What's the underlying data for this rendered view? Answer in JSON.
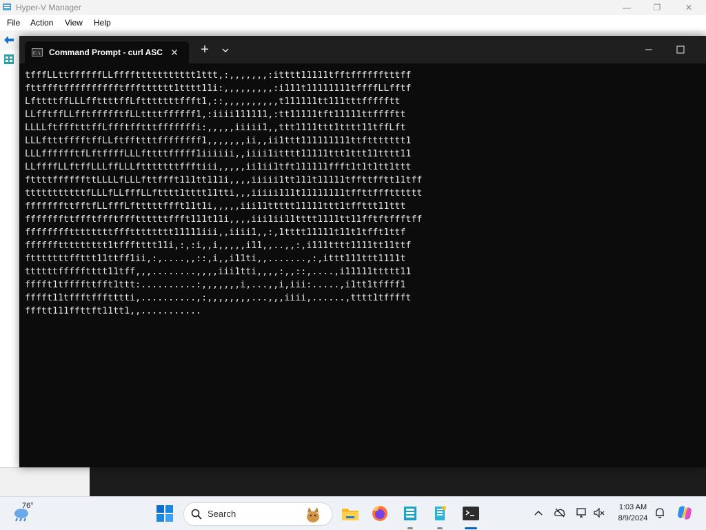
{
  "hyperv": {
    "title": "Hyper-V Manager",
    "menu": [
      "File",
      "Action",
      "View",
      "Help"
    ]
  },
  "terminal": {
    "tab_title": "Command Prompt - curl  ASC",
    "new_tab_symbol": "+",
    "close_symbol": "✕",
    "output_lines": [
      "tfffLLttffffffLLffffttttttttttt1ttt,:,,,,,,,:itttt11111tfftfffffftttff",
      "fttffftfffffffffftffftttttt1tttt11i:,,,,,,,,,:i111t11111111tffffLLfftf",
      "LfttttffLLLffttttffLftttttttffft1,::,,,,,,,,,,t111111tt111tttffffftt",
      "LLfftffLLfftffffftfLLttttffffff1,:iiii111111,:tt11111tft11111ttfffftt",
      "LLLLftffftttffLffftfftttfffffffi:,,,,,iiiii1,,ttt1111ttt1tttt11tffLft",
      "LLLftttfffftffLLftffttttffffffff1,,,,,,,ii,,ii1ttt111111111ttfttttttt1",
      "LLLfffffftfLftffffLLLfttttfffff1iiiiii,,iiii1itttt11111ttt1ttt11tttt11",
      "LLffffLLftffLLLffLLLftttttttffftiii,,,,,ii1ii1tft111111ffft1t1t1tt1ttt",
      "fttttffffffttLLLLfLLLfttffft111tt111i,,,,iiiii1tt111t11111tffttfftt11tff",
      "tttttttttttfLLLfLLfffLLftttt1tttt11tti,,,iiiii111t11111111tffttffftttttt",
      "fffffffttfftfLLfffLftttttffft11t1i,,,,,iii11ttttt11111ttt1tffttt11ttt",
      "fffffffttffftffftfffttttttffft111t11i,,,,iii1ii11tttt1111tt11fftftffftff",
      "ffffffffttttttttffftttttttt11111iii,,iiii1,,:,1tttt11111t11t1tfft1ttf",
      "ffffffttttttttt1tffftttt11i,:,:i,,i,,,,,i11,,..,,:,i111tttt1111tt11ttf",
      "ftttttttffttt11ttff1ii,:,....,,::,i,,i11ti,,.......,:,ittt111ttt1111t",
      "ttttttffffftttt11tff,,,........,,,,iii1tti,,,,:,,::,....,i11111ttttt11",
      "fffft1tffffttfft1ttt:..........:,,,,,,,i,...,,i,iii:.....,i1tt1tffff1",
      "fffft11tffftffftttti,..........,:,,,,,,,,...,,,iiii,......,tttt1tfffft",
      "ffftt111ffttft11tt1,,..........."
    ]
  },
  "taskbar": {
    "weather_temp": "76°",
    "search_placeholder": "Search",
    "time": "1:03 AM",
    "date": "8/9/2024",
    "pinned_apps": [
      "file-explorer-icon",
      "firefox-icon",
      "hyper-v-manager-icon",
      "hyper-v-icon",
      "terminal-icon"
    ],
    "tray_icons": [
      "chevron-up-icon",
      "cloud-offline-icon",
      "network-icon",
      "volume-icon",
      "notification-bell-icon",
      "copilot-icon"
    ],
    "accent_color": "#0067c0"
  }
}
